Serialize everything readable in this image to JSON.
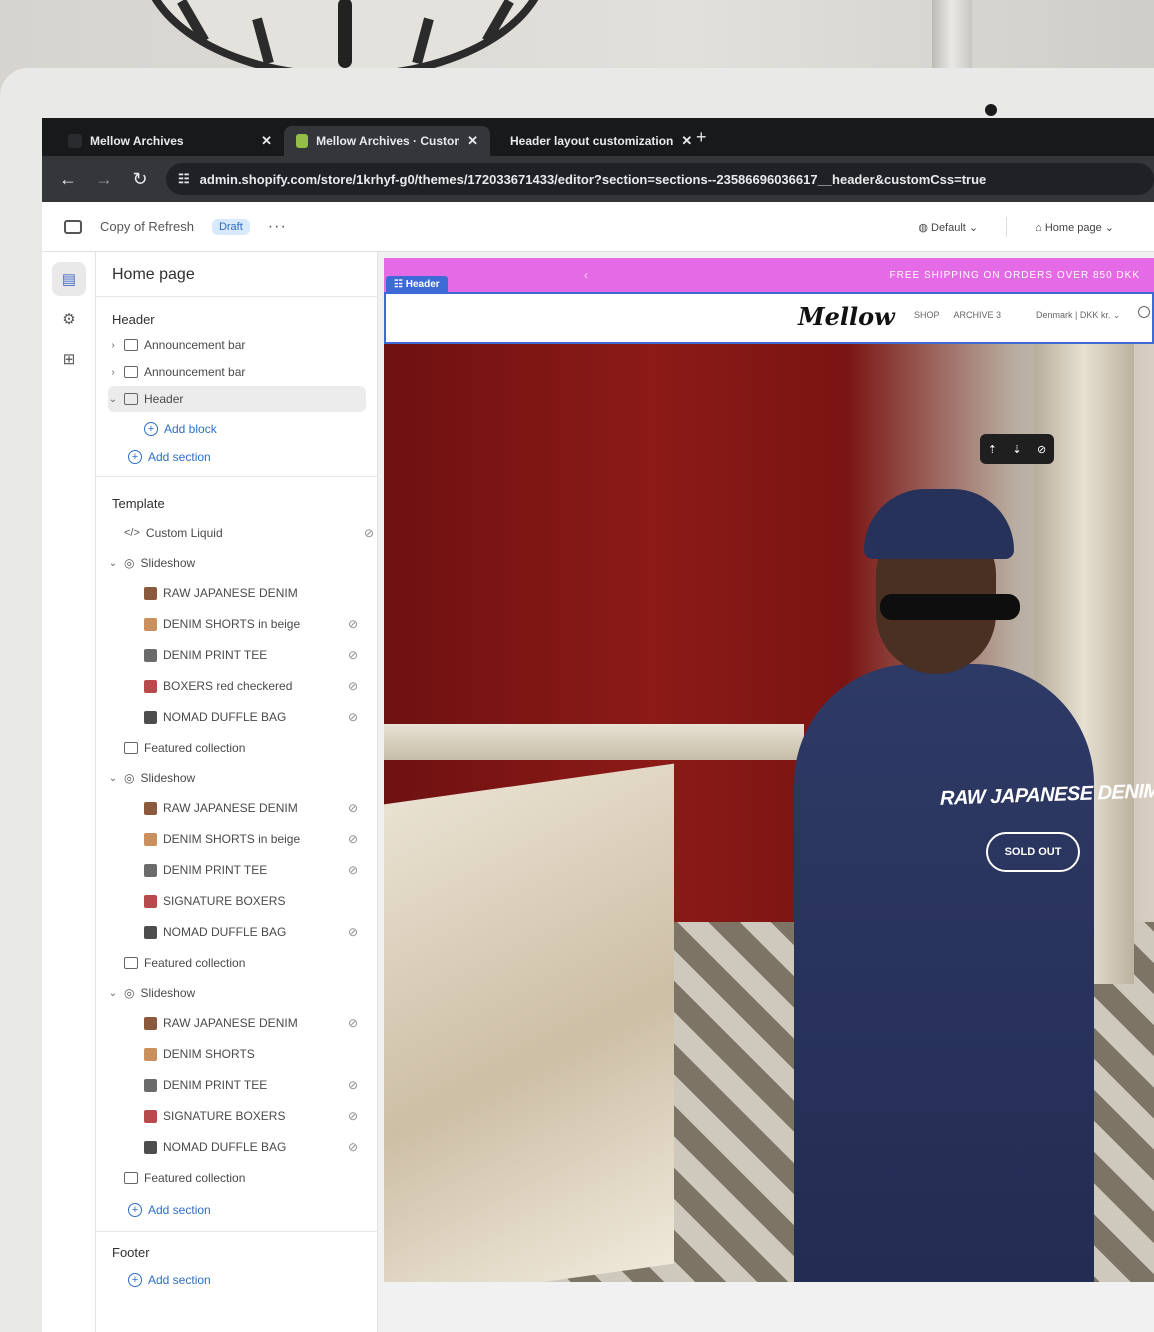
{
  "browser": {
    "tabs": [
      {
        "label": "Mellow Archives",
        "active": false,
        "favicon_color": "#2a2b2e"
      },
      {
        "label": "Mellow Archives · Customize",
        "active": true,
        "favicon_color": "#96bf48"
      },
      {
        "label": "Header layout customization",
        "active": false,
        "favicon_color": "#e8eaed"
      }
    ],
    "new_tab": "+",
    "url": "admin.shopify.com/store/1krhyf-g0/themes/172033671433/editor?section=sections--23586696036617__header&customCss=true"
  },
  "editor": {
    "theme_name": "Copy of Refresh",
    "status_badge": "Draft",
    "more": "···",
    "view_selector": "Default",
    "page_selector": "Home page",
    "panel_title": "Home page",
    "header_group": {
      "label": "Header",
      "items": [
        {
          "label": "Announcement bar",
          "expanded": false
        },
        {
          "label": "Announcement bar",
          "expanded": false
        },
        {
          "label": "Header",
          "expanded": true,
          "selected": true
        }
      ],
      "add_block": "Add block",
      "add_section": "Add section"
    },
    "template_group": {
      "label": "Template",
      "items": [
        {
          "label": "Custom Liquid",
          "type": "code",
          "hidden": true
        },
        {
          "label": "Slideshow",
          "type": "slideshow"
        },
        {
          "label": "RAW JAPANESE DENIM",
          "type": "slide",
          "hidden": false
        },
        {
          "label": "DENIM SHORTS in beige",
          "type": "slide",
          "hidden": true
        },
        {
          "label": "DENIM PRINT TEE",
          "type": "slide",
          "hidden": true
        },
        {
          "label": "BOXERS red checkered",
          "type": "slide",
          "hidden": true
        },
        {
          "label": "NOMAD DUFFLE BAG",
          "type": "slide",
          "hidden": true
        },
        {
          "label": "Featured collection",
          "type": "collection"
        },
        {
          "label": "Slideshow",
          "type": "slideshow"
        },
        {
          "label": "RAW JAPANESE DENIM",
          "type": "slide",
          "hidden": true
        },
        {
          "label": "DENIM SHORTS in beige",
          "type": "slide",
          "hidden": true
        },
        {
          "label": "DENIM PRINT TEE",
          "type": "slide",
          "hidden": true
        },
        {
          "label": "SIGNATURE BOXERS",
          "type": "slide",
          "hidden": false
        },
        {
          "label": "NOMAD DUFFLE BAG",
          "type": "slide",
          "hidden": true
        },
        {
          "label": "Featured collection",
          "type": "collection"
        },
        {
          "label": "Slideshow",
          "type": "slideshow"
        },
        {
          "label": "RAW JAPANESE DENIM",
          "type": "slide",
          "hidden": true
        },
        {
          "label": "DENIM SHORTS",
          "type": "slide",
          "hidden": false
        },
        {
          "label": "DENIM PRINT TEE",
          "type": "slide",
          "hidden": true
        },
        {
          "label": "SIGNATURE BOXERS",
          "type": "slide",
          "hidden": true
        },
        {
          "label": "NOMAD DUFFLE BAG",
          "type": "slide",
          "hidden": true
        },
        {
          "label": "Featured collection",
          "type": "collection"
        }
      ],
      "add_section": "Add section"
    },
    "footer_group": {
      "label": "Footer",
      "add_section": "Add section"
    }
  },
  "preview": {
    "announcement": "FREE SHIPPING ON ORDERS OVER 850 DKK",
    "header_tag": "Header",
    "logo": "Mellow",
    "menu": [
      "SHOP",
      "ARCHIVE 3"
    ],
    "locale": "Denmark | DKK kr.",
    "hero_title": "RAW JAPANESE DENIM",
    "hero_button": "SOLD OUT",
    "accent_color": "#e46ae6",
    "selection_color": "#3d6bd6"
  }
}
